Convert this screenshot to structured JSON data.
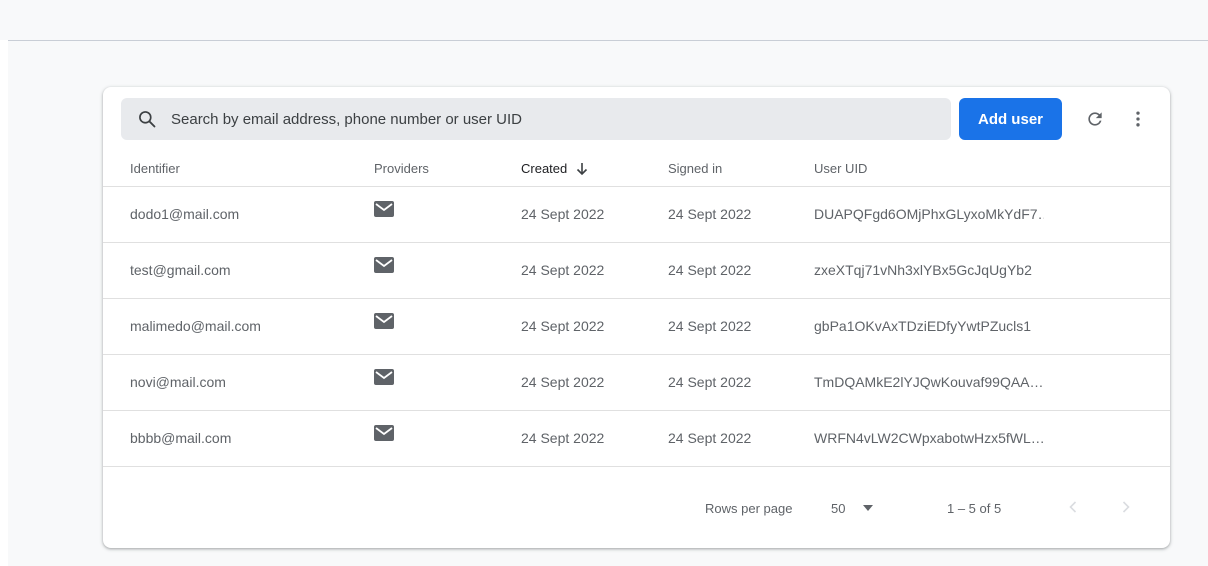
{
  "search": {
    "placeholder": "Search by email address, phone number or user UID"
  },
  "toolbar": {
    "add_user_label": "Add user",
    "refresh_icon": "refresh-icon",
    "more_icon": "more-vert-icon"
  },
  "table": {
    "columns": {
      "identifier": "Identifier",
      "providers": "Providers",
      "created": "Created",
      "signed_in": "Signed in",
      "user_uid": "User UID"
    },
    "sort": {
      "column": "created",
      "direction": "descending"
    },
    "rows": [
      {
        "identifier": "dodo1@mail.com",
        "provider": "email-icon",
        "created": "24 Sept 2022",
        "signed_in": "24 Sept 2022",
        "uid": "DUAPQFgd6OMjPhxGLyxoMkYdF7…"
      },
      {
        "identifier": "test@gmail.com",
        "provider": "email-icon",
        "created": "24 Sept 2022",
        "signed_in": "24 Sept 2022",
        "uid": "zxeXTqj71vNh3xlYBx5GcJqUgYb2"
      },
      {
        "identifier": "malimedo@mail.com",
        "provider": "email-icon",
        "created": "24 Sept 2022",
        "signed_in": "24 Sept 2022",
        "uid": "gbPa1OKvAxTDziEDfyYwtPZucls1"
      },
      {
        "identifier": "novi@mail.com",
        "provider": "email-icon",
        "created": "24 Sept 2022",
        "signed_in": "24 Sept 2022",
        "uid": "TmDQAMkE2lYJQwKouvaf99QAA…"
      },
      {
        "identifier": "bbbb@mail.com",
        "provider": "email-icon",
        "created": "24 Sept 2022",
        "signed_in": "24 Sept 2022",
        "uid": "WRFN4vLW2CWpxabotwHzx5fWL…"
      }
    ]
  },
  "pagination": {
    "rows_per_page_label": "Rows per page",
    "rows_per_page_value": "50",
    "range_label": "1 – 5 of 5"
  },
  "colors": {
    "accent": "#1a73e8",
    "page_background": "#f8f9fa",
    "search_background": "#e8eaed",
    "text_secondary": "#5f6368"
  }
}
